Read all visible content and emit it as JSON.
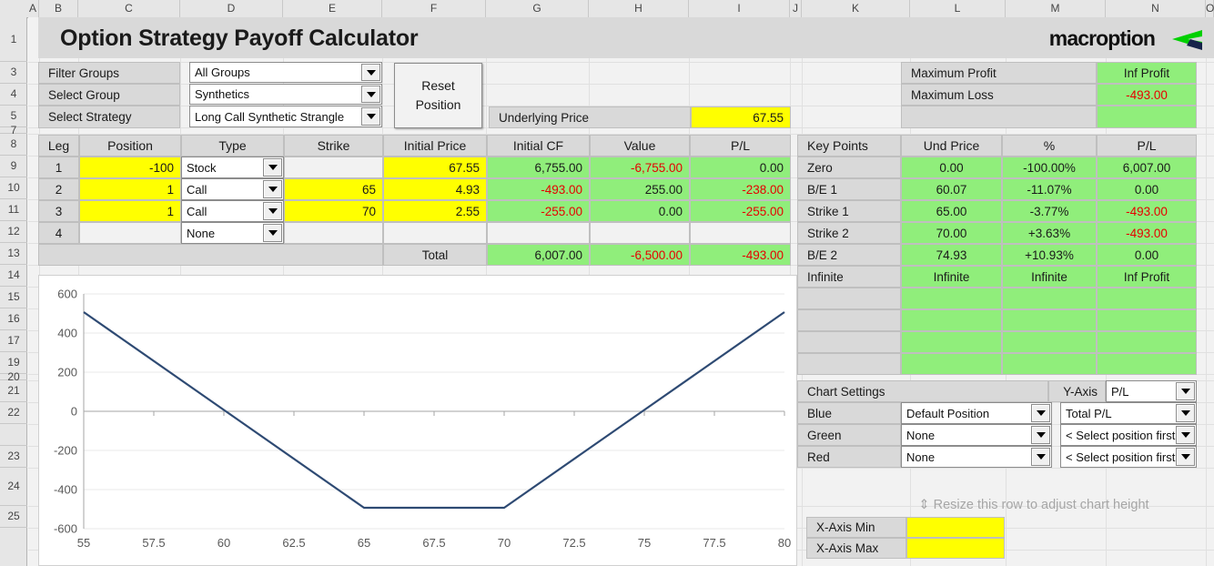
{
  "app": {
    "title": "Option Strategy Payoff Calculator",
    "brand": "macroption"
  },
  "columns": [
    "A",
    "B",
    "C",
    "D",
    "E",
    "F",
    "G",
    "H",
    "I",
    "J",
    "K",
    "L",
    "M",
    "N",
    "O"
  ],
  "rows": [
    "1",
    "3",
    "4",
    "5",
    "7",
    "8",
    "9",
    "10",
    "11",
    "12",
    "13",
    "14",
    "15",
    "16",
    "17",
    "19",
    "20",
    "21",
    "22",
    "",
    "23",
    "24",
    "25"
  ],
  "selectors": {
    "filter_groups_label": "Filter Groups",
    "filter_groups_value": "All Groups",
    "select_group_label": "Select Group",
    "select_group_value": "Synthetics",
    "select_strategy_label": "Select Strategy",
    "select_strategy_value": "Long Call Synthetic Strangle",
    "reset_line1": "Reset",
    "reset_line2": "Position"
  },
  "underlying": {
    "label": "Underlying Price",
    "value": "67.55"
  },
  "summary": {
    "max_profit_label": "Maximum Profit",
    "max_profit_value": "Inf Profit",
    "max_loss_label": "Maximum Loss",
    "max_loss_value": "-493.00",
    "blank_label": "",
    "blank_value": ""
  },
  "legs_table": {
    "headers": [
      "Leg",
      "Position",
      "Type",
      "Strike",
      "Initial Price",
      "Initial CF",
      "Value",
      "P/L"
    ],
    "rows": [
      {
        "leg": "1",
        "position": "-100",
        "type": "Stock",
        "strike": "",
        "initial_price": "67.55",
        "initial_cf": "6,755.00",
        "value": "-6,755.00",
        "pl": "0.00",
        "cf_neg": false,
        "value_neg": true,
        "pl_neg": false,
        "strike_editable": false
      },
      {
        "leg": "2",
        "position": "1",
        "type": "Call",
        "strike": "65",
        "initial_price": "4.93",
        "initial_cf": "-493.00",
        "value": "255.00",
        "pl": "-238.00",
        "cf_neg": true,
        "value_neg": false,
        "pl_neg": true,
        "strike_editable": true
      },
      {
        "leg": "3",
        "position": "1",
        "type": "Call",
        "strike": "70",
        "initial_price": "2.55",
        "initial_cf": "-255.00",
        "value": "0.00",
        "pl": "-255.00",
        "cf_neg": true,
        "value_neg": false,
        "pl_neg": true,
        "strike_editable": true
      },
      {
        "leg": "4",
        "position": "",
        "type": "None",
        "strike": "",
        "initial_price": "",
        "initial_cf": "",
        "value": "",
        "pl": "",
        "cf_neg": false,
        "value_neg": false,
        "pl_neg": false,
        "strike_editable": false
      }
    ],
    "total_label": "Total",
    "total_initial_cf": "6,007.00",
    "total_value": "-6,500.00",
    "total_pl": "-493.00"
  },
  "key_points": {
    "headers": [
      "Key Points",
      "Und Price",
      "%",
      "P/L"
    ],
    "rows": [
      {
        "name": "Zero",
        "und_price": "0.00",
        "pct": "-100.00%",
        "pl": "6,007.00",
        "pl_neg": false
      },
      {
        "name": "B/E 1",
        "und_price": "60.07",
        "pct": "-11.07%",
        "pl": "0.00",
        "pl_neg": false
      },
      {
        "name": "Strike 1",
        "und_price": "65.00",
        "pct": "-3.77%",
        "pl": "-493.00",
        "pl_neg": true
      },
      {
        "name": "Strike 2",
        "und_price": "70.00",
        "pct": "+3.63%",
        "pl": "-493.00",
        "pl_neg": true
      },
      {
        "name": "B/E 2",
        "und_price": "74.93",
        "pct": "+10.93%",
        "pl": "0.00",
        "pl_neg": false
      },
      {
        "name": "Infinite",
        "und_price": "Infinite",
        "pct": "Infinite",
        "pl": "Inf Profit",
        "pl_neg": false
      },
      {
        "name": "",
        "und_price": "",
        "pct": "",
        "pl": "",
        "pl_neg": false
      },
      {
        "name": "",
        "und_price": "",
        "pct": "",
        "pl": "",
        "pl_neg": false
      },
      {
        "name": "",
        "und_price": "",
        "pct": "",
        "pl": "",
        "pl_neg": false
      },
      {
        "name": "",
        "und_price": "",
        "pct": "",
        "pl": "",
        "pl_neg": false
      }
    ]
  },
  "chart_settings": {
    "title": "Chart Settings",
    "yaxis_label": "Y-Axis",
    "yaxis_value": "P/L",
    "rows": [
      {
        "color_label": "Blue",
        "position": "Default Position",
        "series": "Total P/L"
      },
      {
        "color_label": "Green",
        "position": "None",
        "series": "< Select position first"
      },
      {
        "color_label": "Red",
        "position": "None",
        "series": "< Select position first"
      }
    ],
    "resize_hint": "⇕ Resize this row to adjust chart height",
    "xmin_label": "X-Axis Min",
    "xmin_value": "",
    "xmax_label": "X-Axis Max",
    "xmax_value": ""
  },
  "chart_data": {
    "type": "line",
    "title": "",
    "xlabel": "",
    "ylabel": "",
    "xlim": [
      55,
      80
    ],
    "ylim": [
      -600,
      600
    ],
    "xticks": [
      "55",
      "57.5",
      "60",
      "62.5",
      "65",
      "67.5",
      "70",
      "72.5",
      "75",
      "77.5",
      "80"
    ],
    "yticks": [
      "600",
      "400",
      "200",
      "0",
      "-200",
      "-400",
      "-600"
    ],
    "grid": true,
    "legend": false,
    "line_color": "#2e4a73",
    "series": [
      {
        "name": "Total P/L",
        "x": [
          55,
          60.07,
          65,
          70,
          74.93,
          80
        ],
        "y": [
          507,
          0,
          -493,
          -493,
          0,
          507
        ]
      }
    ]
  },
  "colors": {
    "green_cell": "#90ee7b",
    "yellow_cell": "#ffff00",
    "label_cell": "#d9d9d9",
    "negative_text": "#e60000",
    "chart_line": "#2e4a73",
    "logo_green": "#00d000",
    "logo_navy": "#16234a"
  }
}
